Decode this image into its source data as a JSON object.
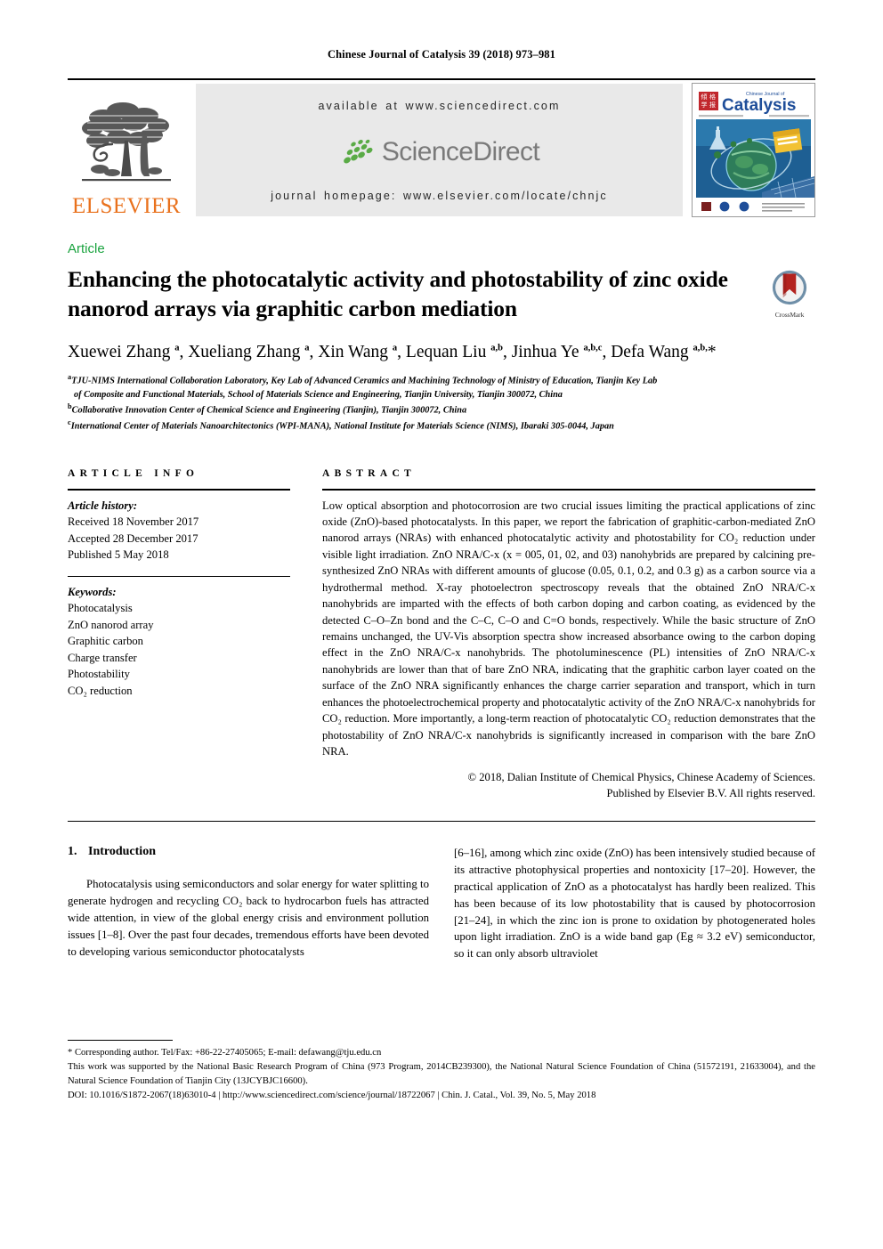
{
  "running_head": "Chinese Journal of Catalysis 39 (2018) 973–981",
  "masthead": {
    "publisher": "ELSEVIER",
    "available_at": "available at www.sciencedirect.com",
    "sciencedirect_wordmark": "ScienceDirect",
    "journal_homepage": "journal homepage: www.elsevier.com/locate/chnjc",
    "cover": {
      "journal_name": "Catalysis",
      "journal_name_prefix": "Chinese Journal of"
    }
  },
  "article_type": "Article",
  "title": "Enhancing the photocatalytic activity and photostability of zinc oxide nanorod arrays via graphitic carbon mediation",
  "crossmark_label": "CrossMark",
  "authors_html": "Xuewei Zhang <sup>a</sup>, Xueliang Zhang <sup>a</sup>, Xin Wang <sup>a</sup>, Lequan Liu <sup>a,b</sup>, Jinhua Ye <sup>a,b,c</sup>, Defa Wang <sup>a,b,</sup>*",
  "affiliations": [
    {
      "mark": "a",
      "line1": "TJU-NIMS International Collaboration Laboratory, Key Lab of Advanced Ceramics and Machining Technology of Ministry of Education, Tianjin Key Lab",
      "line2": "of Composite and Functional Materials, School of Materials Science and Engineering, Tianjin University, Tianjin 300072, China"
    },
    {
      "mark": "b",
      "line1": "Collaborative Innovation Center of Chemical Science and Engineering (Tianjin), Tianjin 300072, China",
      "line2": ""
    },
    {
      "mark": "c",
      "line1": "International Center of Materials Nanoarchitectonics (WPI-MANA), National Institute for Materials Science (NIMS), Ibaraki 305-0044, Japan",
      "line2": ""
    }
  ],
  "article_info": {
    "heading": "ARTICLE INFO",
    "history_label": "Article history:",
    "history": [
      "Received 18 November 2017",
      "Accepted 28 December 2017",
      "Published 5 May 2018"
    ],
    "keywords_label": "Keywords:",
    "keywords": [
      "Photocatalysis",
      "ZnO nanorod array",
      "Graphitic carbon",
      "Charge transfer",
      "Photostability",
      "CO₂ reduction"
    ]
  },
  "abstract": {
    "heading": "ABSTRACT",
    "text": "Low optical absorption and photocorrosion are two crucial issues limiting the practical applications of zinc oxide (ZnO)-based photocatalysts. In this paper, we report the fabrication of graphitic-carbon-mediated ZnO nanorod arrays (NRAs) with enhanced photocatalytic activity and photostability for CO₂ reduction under visible light irradiation. ZnO NRA/C-x (x = 005, 01, 02, and 03) nanohybrids are prepared by calcining pre-synthesized ZnO NRAs with different amounts of glucose (0.05, 0.1, 0.2, and 0.3 g) as a carbon source via a hydrothermal method. X-ray photoelectron spectroscopy reveals that the obtained ZnO NRA/C-x nanohybrids are imparted with the effects of both carbon doping and carbon coating, as evidenced by the detected C–O–Zn bond and the C–C, C–O and C=O bonds, respectively. While the basic structure of ZnO remains unchanged, the UV-Vis absorption spectra show increased absorbance owing to the carbon doping effect in the ZnO NRA/C-x nanohybrids. The photoluminescence (PL) intensities of ZnO NRA/C-x nanohybrids are lower than that of bare ZnO NRA, indicating that the graphitic carbon layer coated on the surface of the ZnO NRA significantly enhances the charge carrier separation and transport, which in turn enhances the photoelectrochemical property and photocatalytic activity of the ZnO NRA/C-x nanohybrids for CO₂ reduction. More importantly, a long-term reaction of photocatalytic CO₂ reduction demonstrates that the photostability of ZnO NRA/C-x nanohybrids is significantly increased in comparison with the bare ZnO NRA.",
    "copyright_line1": "© 2018, Dalian Institute of Chemical Physics, Chinese Academy of Sciences.",
    "copyright_line2": "Published by Elsevier B.V. All rights reserved."
  },
  "intro": {
    "number": "1.",
    "heading": "Introduction",
    "col_left": "Photocatalysis using semiconductors and solar energy for water splitting to generate hydrogen and recycling CO₂ back to hydrocarbon fuels has attracted wide attention, in view of the global energy crisis and environment pollution issues [1–8]. Over the past four decades, tremendous efforts have been devoted to developing various semiconductor photocatalysts",
    "col_right": "[6–16], among which zinc oxide (ZnO) has been intensively studied because of its attractive photophysical properties and nontoxicity [17–20]. However, the practical application of ZnO as a photocatalyst has hardly been realized. This has been because of its low photostability that is caused by photocorrosion [21–24], in which the zinc ion is prone to oxidation by photogenerated holes upon light irradiation. ZnO is a wide band gap (Eg ≈ 3.2 eV) semiconductor, so it can only absorb ultraviolet"
  },
  "footnotes": {
    "corresponding": "* Corresponding author. Tel/Fax: +86-22-27405065; E-mail: defawang@tju.edu.cn",
    "funding": "This work was supported by the National Basic Research Program of China (973 Program, 2014CB239300), the National Natural Science Foundation of China (51572191, 21633004), and the Natural Science Foundation of Tianjin City (13JCYBJC16600).",
    "doi": "DOI: 10.1016/S1872-2067(18)63010-4 | http://www.sciencedirect.com/science/journal/18722067 | Chin. J. Catal., Vol. 39, No. 5, May 2018"
  },
  "colors": {
    "elsevier_orange": "#E9711C",
    "article_green": "#1aa33f",
    "band_grey": "#e9e9e9",
    "sciencedirect_green": "#5aab46",
    "sciencedirect_grey": "#7a7a7a",
    "crossmark_red": "#b4231f",
    "crossmark_blue": "#6f8fa8"
  }
}
